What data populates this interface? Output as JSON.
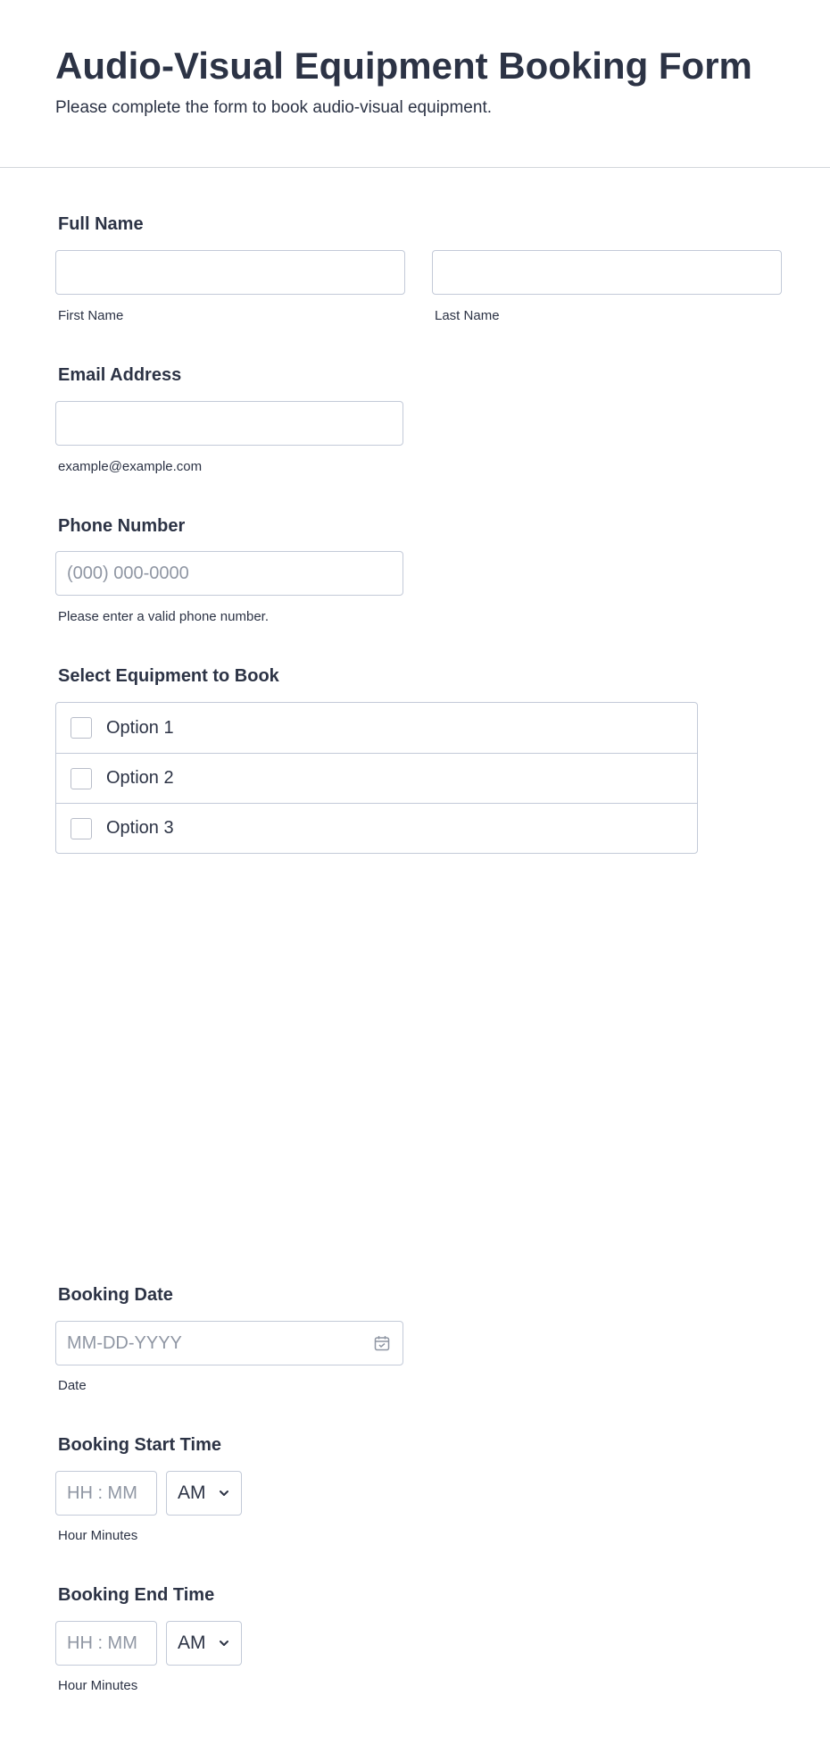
{
  "header": {
    "title": "Audio-Visual Equipment Booking Form",
    "subtitle": "Please complete the form to book audio-visual equipment."
  },
  "full_name": {
    "label": "Full Name",
    "first_sublabel": "First Name",
    "last_sublabel": "Last Name",
    "first_value": "",
    "last_value": ""
  },
  "email": {
    "label": "Email Address",
    "sublabel": "example@example.com",
    "value": ""
  },
  "phone": {
    "label": "Phone Number",
    "placeholder": "(000) 000-0000",
    "sublabel": "Please enter a valid phone number."
  },
  "equipment": {
    "label": "Select Equipment to Book",
    "options": [
      {
        "label": "Option 1",
        "checked": false
      },
      {
        "label": "Option 2",
        "checked": false
      },
      {
        "label": "Option 3",
        "checked": false
      }
    ]
  },
  "booking_date": {
    "label": "Booking Date",
    "placeholder": "MM-DD-YYYY",
    "sublabel": "Date",
    "icon": "calendar-icon"
  },
  "start_time": {
    "label": "Booking Start Time",
    "placeholder": "HH : MM",
    "ampm": "AM",
    "sublabel": "Hour Minutes"
  },
  "end_time": {
    "label": "Booking End Time",
    "placeholder": "HH : MM",
    "ampm": "AM",
    "sublabel": "Hour Minutes"
  }
}
